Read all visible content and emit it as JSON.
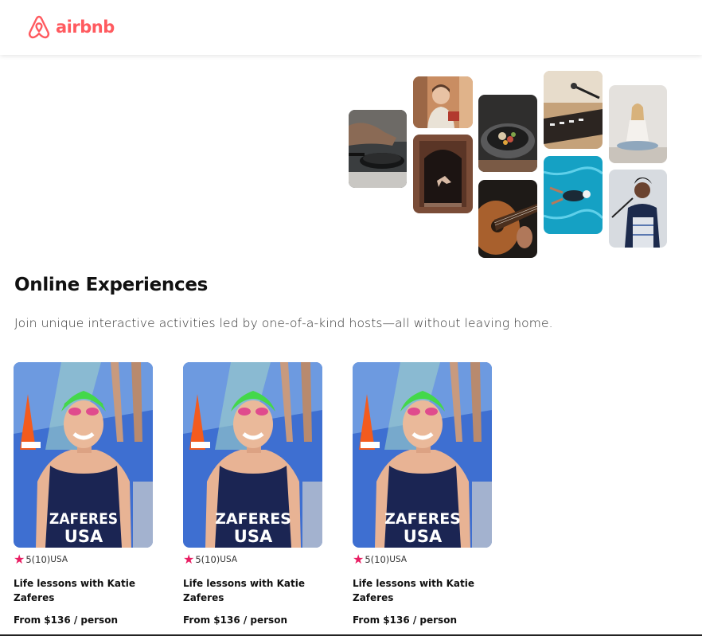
{
  "brand": {
    "name": "airbnb",
    "color": "#FF5A5F",
    "icon": "airbnb-belo-icon"
  },
  "hero": {
    "tiles": [
      {
        "name": "cooking-pan-photo",
        "icon": "cooking-photo"
      },
      {
        "name": "host-portrait-photo",
        "icon": "portrait-photo"
      },
      {
        "name": "dancer-doorway-photo",
        "icon": "dance-photo"
      },
      {
        "name": "food-bowl-photo",
        "icon": "food-photo"
      },
      {
        "name": "guitar-photo",
        "icon": "guitar-photo"
      },
      {
        "name": "dj-mixer-photo",
        "icon": "music-photo"
      },
      {
        "name": "swimmer-pool-photo",
        "icon": "swim-photo"
      },
      {
        "name": "yoga-photo",
        "icon": "yoga-photo"
      },
      {
        "name": "singer-photo",
        "icon": "singer-photo"
      }
    ]
  },
  "section": {
    "title": "Online Experiences",
    "subtitle": "Join unique interactive activities led by one-of-a-kind hosts—all without leaving home."
  },
  "cards": [
    {
      "rating": "5",
      "reviews": "(10)",
      "country": "USA",
      "title": "Life lessons with Katie Zaferes",
      "price": "From $136 / person",
      "photo_icon": "athlete-photo",
      "jersey_top": "ZAFERES",
      "jersey_bottom": "USA"
    },
    {
      "rating": "5",
      "reviews": "(10)",
      "country": "USA",
      "title": "Life lessons with Katie Zaferes",
      "price": "From $136 / person",
      "photo_icon": "athlete-photo",
      "jersey_top": "ZAFERES",
      "jersey_bottom": "USA"
    },
    {
      "rating": "5",
      "reviews": "(10)",
      "country": "USA",
      "title": "Life lessons with Katie Zaferes",
      "price": "From $136 / person",
      "photo_icon": "athlete-photo",
      "jersey_top": "ZAFERES",
      "jersey_bottom": "USA"
    }
  ],
  "colors": {
    "star": "#E91E63",
    "text": "#222222"
  }
}
